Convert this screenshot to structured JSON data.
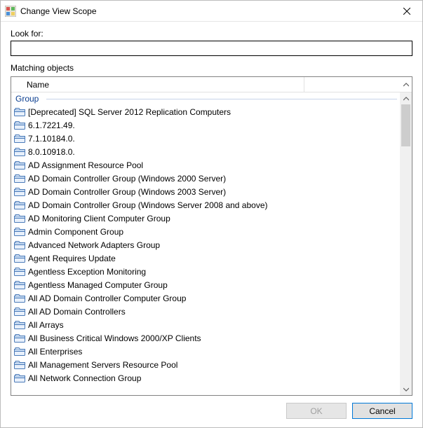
{
  "window": {
    "title": "Change View Scope"
  },
  "search": {
    "label": "Look for:",
    "value": ""
  },
  "list": {
    "label": "Matching objects",
    "column_name": "Name",
    "group_label": "Group",
    "items": [
      "[Deprecated] SQL Server 2012 Replication Computers",
      "6.1.7221.49.",
      "7.1.10184.0.",
      "8.0.10918.0.",
      "AD Assignment Resource Pool",
      "AD Domain Controller Group (Windows 2000 Server)",
      "AD Domain Controller Group (Windows 2003 Server)",
      "AD Domain Controller Group (Windows Server 2008 and above)",
      "AD Monitoring Client Computer Group",
      "Admin Component Group",
      "Advanced Network Adapters Group",
      "Agent Requires Update",
      "Agentless Exception Monitoring",
      "Agentless Managed Computer Group",
      "All AD Domain Controller Computer Group",
      "All AD Domain Controllers",
      "All Arrays",
      "All Business Critical Windows 2000/XP Clients",
      "All Enterprises",
      "All Management Servers Resource Pool",
      "All Network Connection Group"
    ]
  },
  "buttons": {
    "ok": "OK",
    "cancel": "Cancel"
  }
}
